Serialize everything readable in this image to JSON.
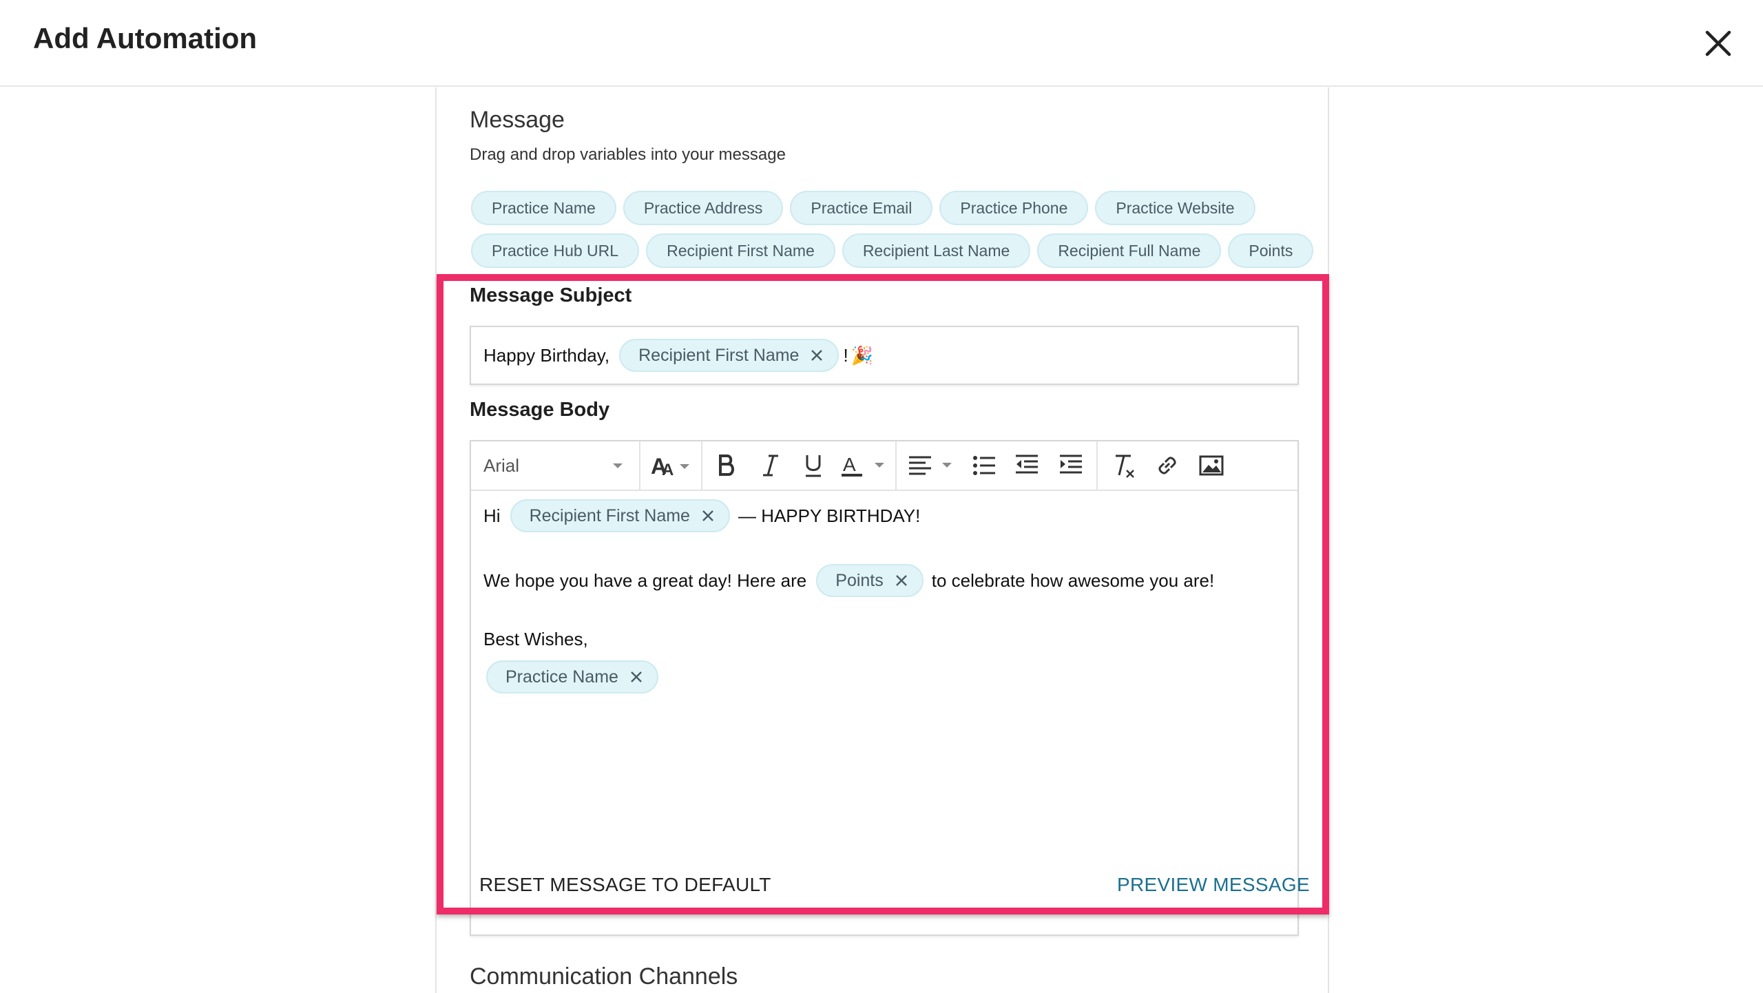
{
  "header": {
    "title": "Add Automation",
    "close_icon": "close-icon"
  },
  "message": {
    "title": "Message",
    "hint": "Drag and drop variables into your message",
    "variables_row1": [
      "Practice Name",
      "Practice Address",
      "Practice Email",
      "Practice Phone",
      "Practice Website"
    ],
    "variables_row2": [
      "Practice Hub URL",
      "Recipient First Name",
      "Recipient Last Name",
      "Recipient Full Name",
      "Points"
    ]
  },
  "subject": {
    "label": "Message Subject",
    "prefix": "Happy Birthday,",
    "chip": "Recipient First Name",
    "suffix": "!",
    "emoji": "🎉"
  },
  "body": {
    "label": "Message Body",
    "font": "Arial",
    "line1_prefix": "Hi",
    "line1_chip": "Recipient First Name",
    "line1_suffix": "— HAPPY BIRTHDAY!",
    "line2_prefix": "We hope you have a great day! Here are",
    "line2_chip": "Points",
    "line2_suffix": "to celebrate how awesome you are!",
    "line3": "Best Wishes,",
    "line4_chip": "Practice Name"
  },
  "toolbar_icons": [
    "font-size-icon",
    "bold-icon",
    "italic-icon",
    "underline-icon",
    "font-color-icon",
    "align-left-icon",
    "bulleted-list-icon",
    "outdent-icon",
    "indent-icon",
    "clear-formatting-icon",
    "link-icon",
    "image-icon"
  ],
  "actions": {
    "reset": "RESET MESSAGE TO DEFAULT",
    "preview": "PREVIEW MESSAGE"
  },
  "channels": {
    "title": "Communication Channels"
  },
  "colors": {
    "highlight": "#ee2c68",
    "chip_bg": "#e1f4f8",
    "link": "#1b6f8f"
  }
}
